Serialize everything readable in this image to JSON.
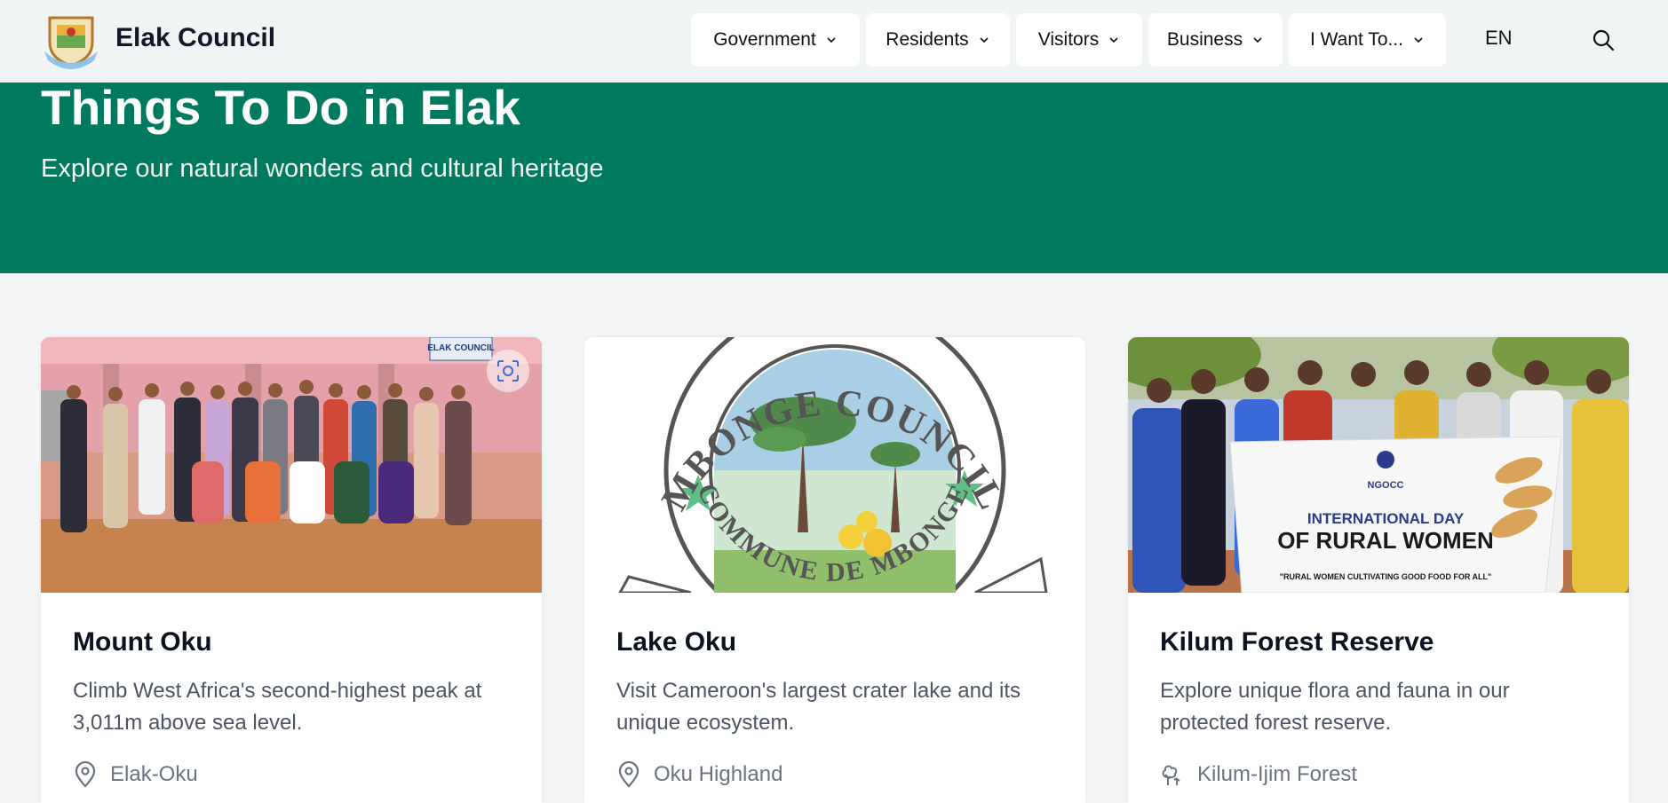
{
  "header": {
    "brand": "Elak Council",
    "logo_icon": "council-crest",
    "nav": [
      {
        "label": "Government"
      },
      {
        "label": "Residents"
      },
      {
        "label": "Visitors"
      },
      {
        "label": "Business"
      },
      {
        "label": "I Want To..."
      }
    ],
    "language": "EN",
    "search_icon": "search-icon"
  },
  "hero": {
    "title": "Things To Do in Elak",
    "subtitle": "Explore our natural wonders and cultural heritage",
    "background": "#007a5e"
  },
  "cards": [
    {
      "title": "Mount Oku",
      "description": "Climb West Africa's second-highest peak at 3,011m above sea level.",
      "location": "Elak-Oku",
      "location_icon": "map-pin-icon",
      "image_sign": "ELAK COUNCIL"
    },
    {
      "title": "Lake Oku",
      "description": "Visit Cameroon's largest crater lake and its unique ecosystem.",
      "location": "Oku Highland",
      "location_icon": "map-pin-icon",
      "image_text_top": "MBONGE COUNCIL",
      "image_text_bottom": "COMMUNE DE MBONGE"
    },
    {
      "title": "Kilum Forest Reserve",
      "description": "Explore unique flora and fauna in our protected forest reserve.",
      "location": "Kilum-Ijim Forest",
      "location_icon": "tree-icon",
      "banner_org": "NGOCC",
      "banner_line1": "INTERNATIONAL DAY",
      "banner_line2": "OF RURAL WOMEN",
      "banner_theme": "\"RURAL WOMEN CULTIVATING GOOD FOOD FOR ALL\""
    }
  ]
}
